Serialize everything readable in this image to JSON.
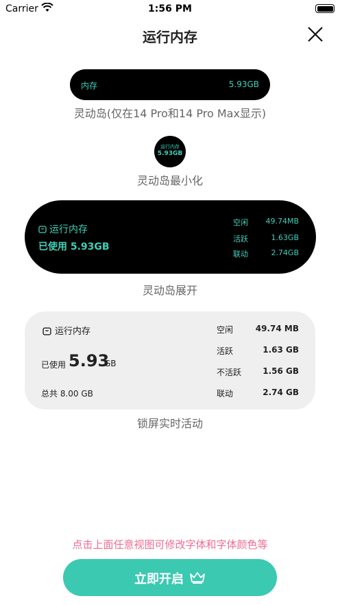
{
  "status_bar": {
    "carrier": "Carrier",
    "time": "1:56 PM"
  },
  "nav": {
    "title": "运行内存"
  },
  "island_pill": {
    "label": "内存",
    "value": "5.93GB",
    "caption": "灵动岛(仅在14 Pro和14 Pro Max显示)"
  },
  "island_min": {
    "label": "运行内存",
    "value": "5.93GB",
    "caption": "灵动岛最小化"
  },
  "island_expanded": {
    "title": "运行内存",
    "used": "已使用 5.93GB",
    "rows": [
      {
        "label": "空闲",
        "value": "49.74MB"
      },
      {
        "label": "活跃",
        "value": "1.63GB"
      },
      {
        "label": "联动",
        "value": "2.74GB"
      }
    ],
    "caption": "灵动岛展开"
  },
  "lock_card": {
    "title": "运行内存",
    "used_label": "已使用",
    "used_value": "5.93",
    "used_unit": "GB",
    "total": "总共 8.00 GB",
    "rows": [
      {
        "label": "空闲",
        "value": "49.74 MB"
      },
      {
        "label": "活跃",
        "value": "1.63 GB"
      },
      {
        "label": "不活跃",
        "value": "1.56 GB"
      },
      {
        "label": "联动",
        "value": "2.74 GB"
      }
    ],
    "caption": "锁屏实时活动"
  },
  "hint": "点击上面任意视图可修改字体和字体颜色等",
  "start_button": {
    "label": "立即开启"
  },
  "colors": {
    "accent": "#3bc9b2",
    "island_text": "#3ed0b9",
    "hint": "#f06b91"
  }
}
